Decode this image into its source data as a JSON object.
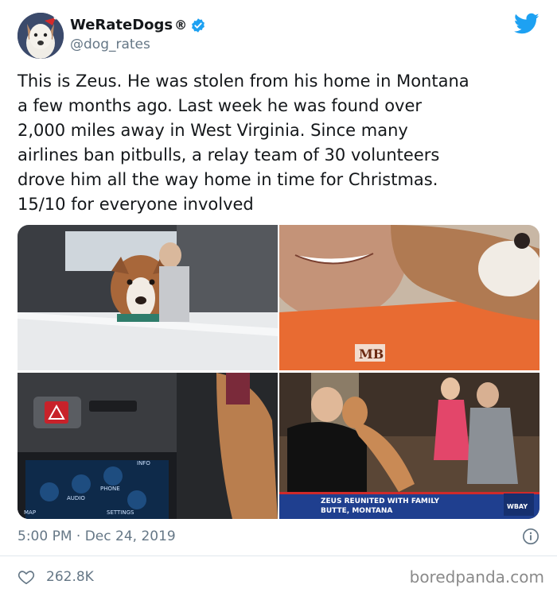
{
  "tweet": {
    "display_name": "WeRateDogs",
    "registered_mark": "®",
    "handle": "@dog_rates",
    "text": "This is Zeus. He was stolen from his home in Montana\na few months ago. Last week he was found over\n2,000 miles away in West Virginia. Since many\nairlines ban pitbulls, a relay team of 30 volunteers\ndrove him all the way home in time for Christmas.\n15/10 for everyone involved",
    "time": "5:00 PM",
    "separator": "·",
    "date": "Dec 24, 2019",
    "likes": "262.8K"
  },
  "media": {
    "photo3_screen_labels": [
      "MAP",
      "AUDIO",
      "PHONE",
      "SETTINGS",
      "INFO"
    ],
    "photo2_shirt_text": "MB",
    "news_caption_line1": "ZEUS REUNITED WITH FAMILY",
    "news_caption_line2": "BUTTE, MONTANA",
    "news_station": "WBAY"
  },
  "watermark": "boredpanda.com",
  "colors": {
    "twitter_blue": "#1da1f2",
    "text": "#14171a",
    "muted": "#657786"
  },
  "icons": [
    "verified-badge-icon",
    "twitter-bird-icon",
    "info-icon",
    "heart-icon"
  ]
}
